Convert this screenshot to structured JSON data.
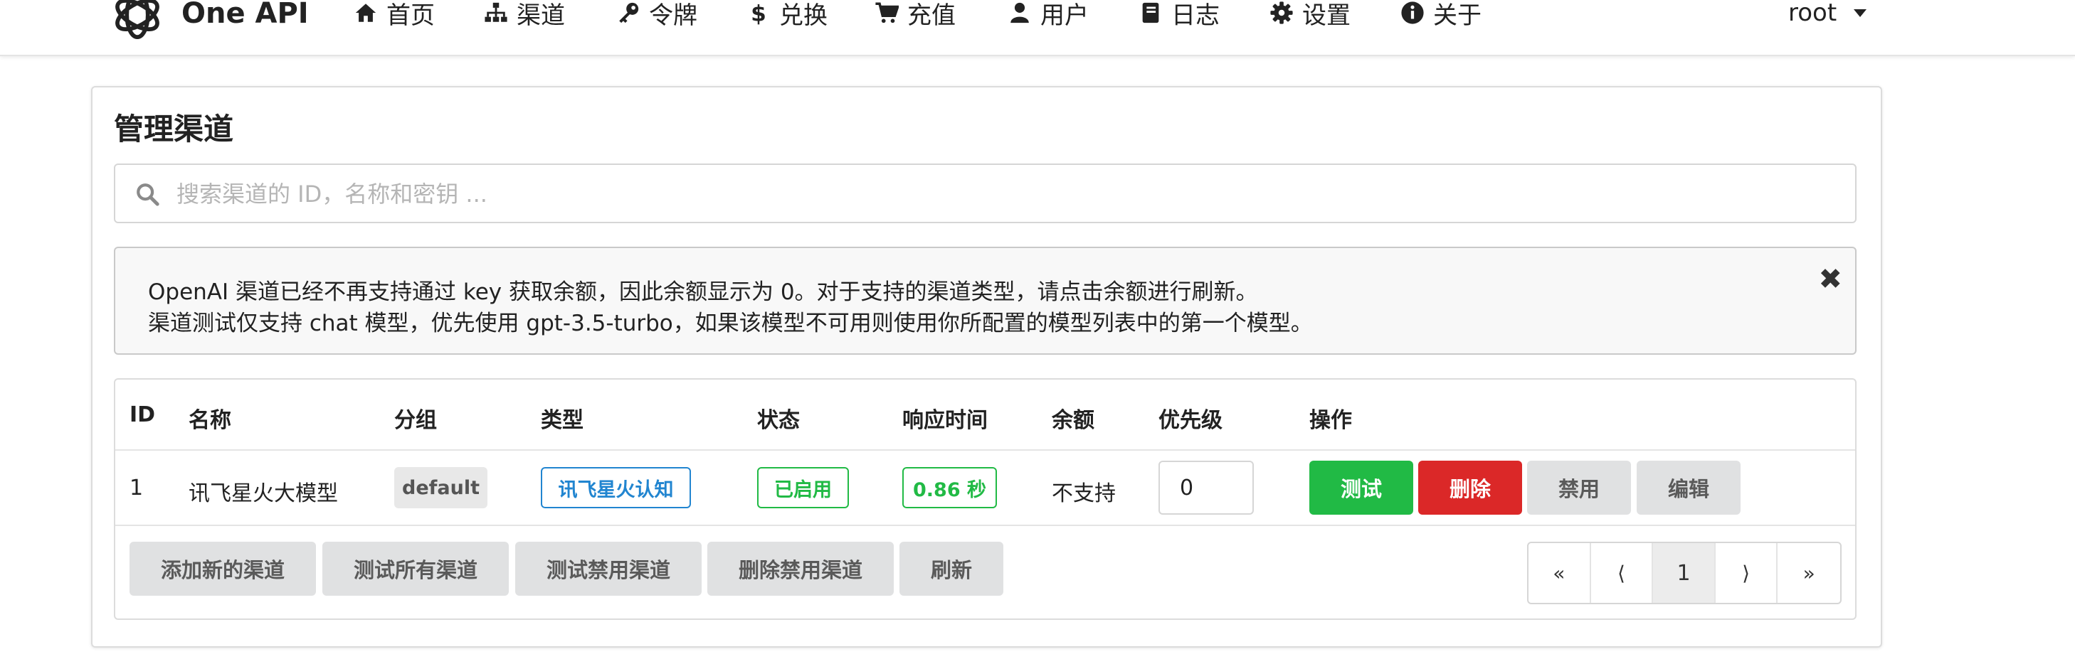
{
  "brand": {
    "name": "One API"
  },
  "nav": [
    {
      "label": "首页",
      "icon": "home-icon"
    },
    {
      "label": "渠道",
      "icon": "sitemap-icon"
    },
    {
      "label": "令牌",
      "icon": "key-icon"
    },
    {
      "label": "兑换",
      "icon": "dollar-icon"
    },
    {
      "label": "充值",
      "icon": "cart-icon"
    },
    {
      "label": "用户",
      "icon": "user-icon"
    },
    {
      "label": "日志",
      "icon": "book-icon"
    },
    {
      "label": "设置",
      "icon": "gear-icon"
    },
    {
      "label": "关于",
      "icon": "info-icon"
    }
  ],
  "user": {
    "name": "root"
  },
  "page": {
    "title": "管理渠道"
  },
  "search": {
    "placeholder": "搜索渠道的 ID，名称和密钥 ...",
    "value": ""
  },
  "notice": {
    "line1": "OpenAI 渠道已经不再支持通过 key 获取余额，因此余额显示为 0。对于支持的渠道类型，请点击余额进行刷新。",
    "line2": "渠道测试仅支持 chat 模型，优先使用 gpt-3.5-turbo，如果该模型不可用则使用你所配置的模型列表中的第一个模型。",
    "close": "✖"
  },
  "table": {
    "headers": [
      "ID",
      "名称",
      "分组",
      "类型",
      "状态",
      "响应时间",
      "余额",
      "优先级",
      "操作"
    ],
    "rows": [
      {
        "id": "1",
        "name": "讯飞星火大模型",
        "group": "default",
        "type": "讯飞星火认知",
        "status": "已启用",
        "response_time": "0.86 秒",
        "balance": "不支持",
        "priority": "0",
        "actions": {
          "test": "测试",
          "delete": "删除",
          "disable": "禁用",
          "edit": "编辑"
        }
      }
    ]
  },
  "footer_buttons": {
    "add": "添加新的渠道",
    "test_all": "测试所有渠道",
    "test_disabled": "测试禁用渠道",
    "delete_disabled": "删除禁用渠道",
    "refresh": "刷新"
  },
  "pagination": {
    "first": "«",
    "prev": "⟨",
    "current": "1",
    "next": "⟩",
    "last": "»"
  },
  "colors": {
    "green": "#21ba45",
    "red": "#db2828",
    "blue": "#2185d0",
    "grey_button": "#e0e1e2"
  }
}
